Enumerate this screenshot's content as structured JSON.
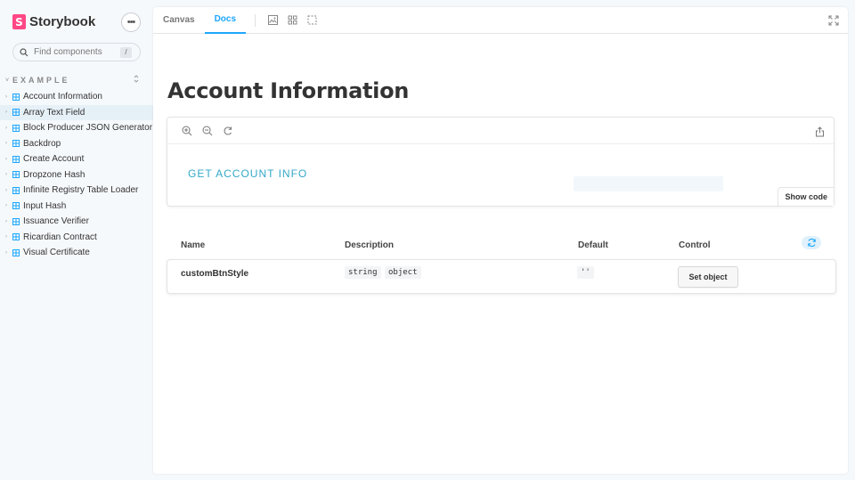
{
  "brand": {
    "logo_letter": "S",
    "name": "Storybook"
  },
  "sidebar": {
    "menu_label": "•••",
    "search": {
      "placeholder": "Find components",
      "shortcut": "/"
    },
    "group": {
      "label": "EXAMPLE"
    },
    "items": [
      {
        "label": "Account Information",
        "active": false
      },
      {
        "label": "Array Text Field",
        "active": true
      },
      {
        "label": "Block Producer JSON Generator",
        "active": false
      },
      {
        "label": "Backdrop",
        "active": false
      },
      {
        "label": "Create Account",
        "active": false
      },
      {
        "label": "Dropzone Hash",
        "active": false
      },
      {
        "label": "Infinite Registry Table Loader",
        "active": false
      },
      {
        "label": "Input Hash",
        "active": false
      },
      {
        "label": "Issuance Verifier",
        "active": false
      },
      {
        "label": "Ricardian Contract",
        "active": false
      },
      {
        "label": "Visual Certificate",
        "active": false
      }
    ]
  },
  "toolbar": {
    "tabs": [
      {
        "label": "Canvas",
        "active": false
      },
      {
        "label": "Docs",
        "active": true
      }
    ],
    "icons": [
      "image-icon",
      "grid-icon",
      "outline-icon",
      "fullscreen-icon"
    ]
  },
  "docs": {
    "title": "Account Information",
    "preview": {
      "button_label": "GET ACCOUNT INFO",
      "show_code_label": "Show code",
      "icons": [
        "zoom-in-icon",
        "zoom-out-icon",
        "zoom-reset-icon",
        "share-icon"
      ]
    },
    "props_table": {
      "headers": {
        "name": "Name",
        "description": "Description",
        "default": "Default",
        "control": "Control"
      },
      "rows": [
        {
          "name": "customBtnStyle",
          "types": [
            "string",
            "object"
          ],
          "default": "''",
          "control_label": "Set object"
        }
      ]
    }
  },
  "colors": {
    "accent": "#1ea7fd",
    "brand": "#ff4785",
    "story_button": "#33a8c8",
    "active_item_bg": "#e6f0f7"
  }
}
